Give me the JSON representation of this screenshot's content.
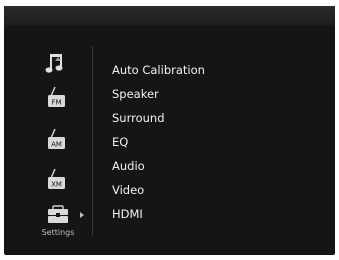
{
  "sidebar": {
    "icons": [
      {
        "name": "music-note-icon"
      },
      {
        "name": "fm-radio-icon",
        "badge": "FM"
      },
      {
        "name": "am-radio-icon",
        "badge": "AM"
      },
      {
        "name": "xm-radio-icon",
        "badge": "XM"
      }
    ],
    "settings_label": "Settings"
  },
  "menu": {
    "items": [
      {
        "label": "Auto Calibration"
      },
      {
        "label": "Speaker"
      },
      {
        "label": "Surround"
      },
      {
        "label": "EQ"
      },
      {
        "label": "Audio"
      },
      {
        "label": "Video"
      },
      {
        "label": "HDMI"
      }
    ]
  },
  "colors": {
    "background": "#151515",
    "text": "#f2f2f2",
    "icon": "#d9d9d9"
  }
}
